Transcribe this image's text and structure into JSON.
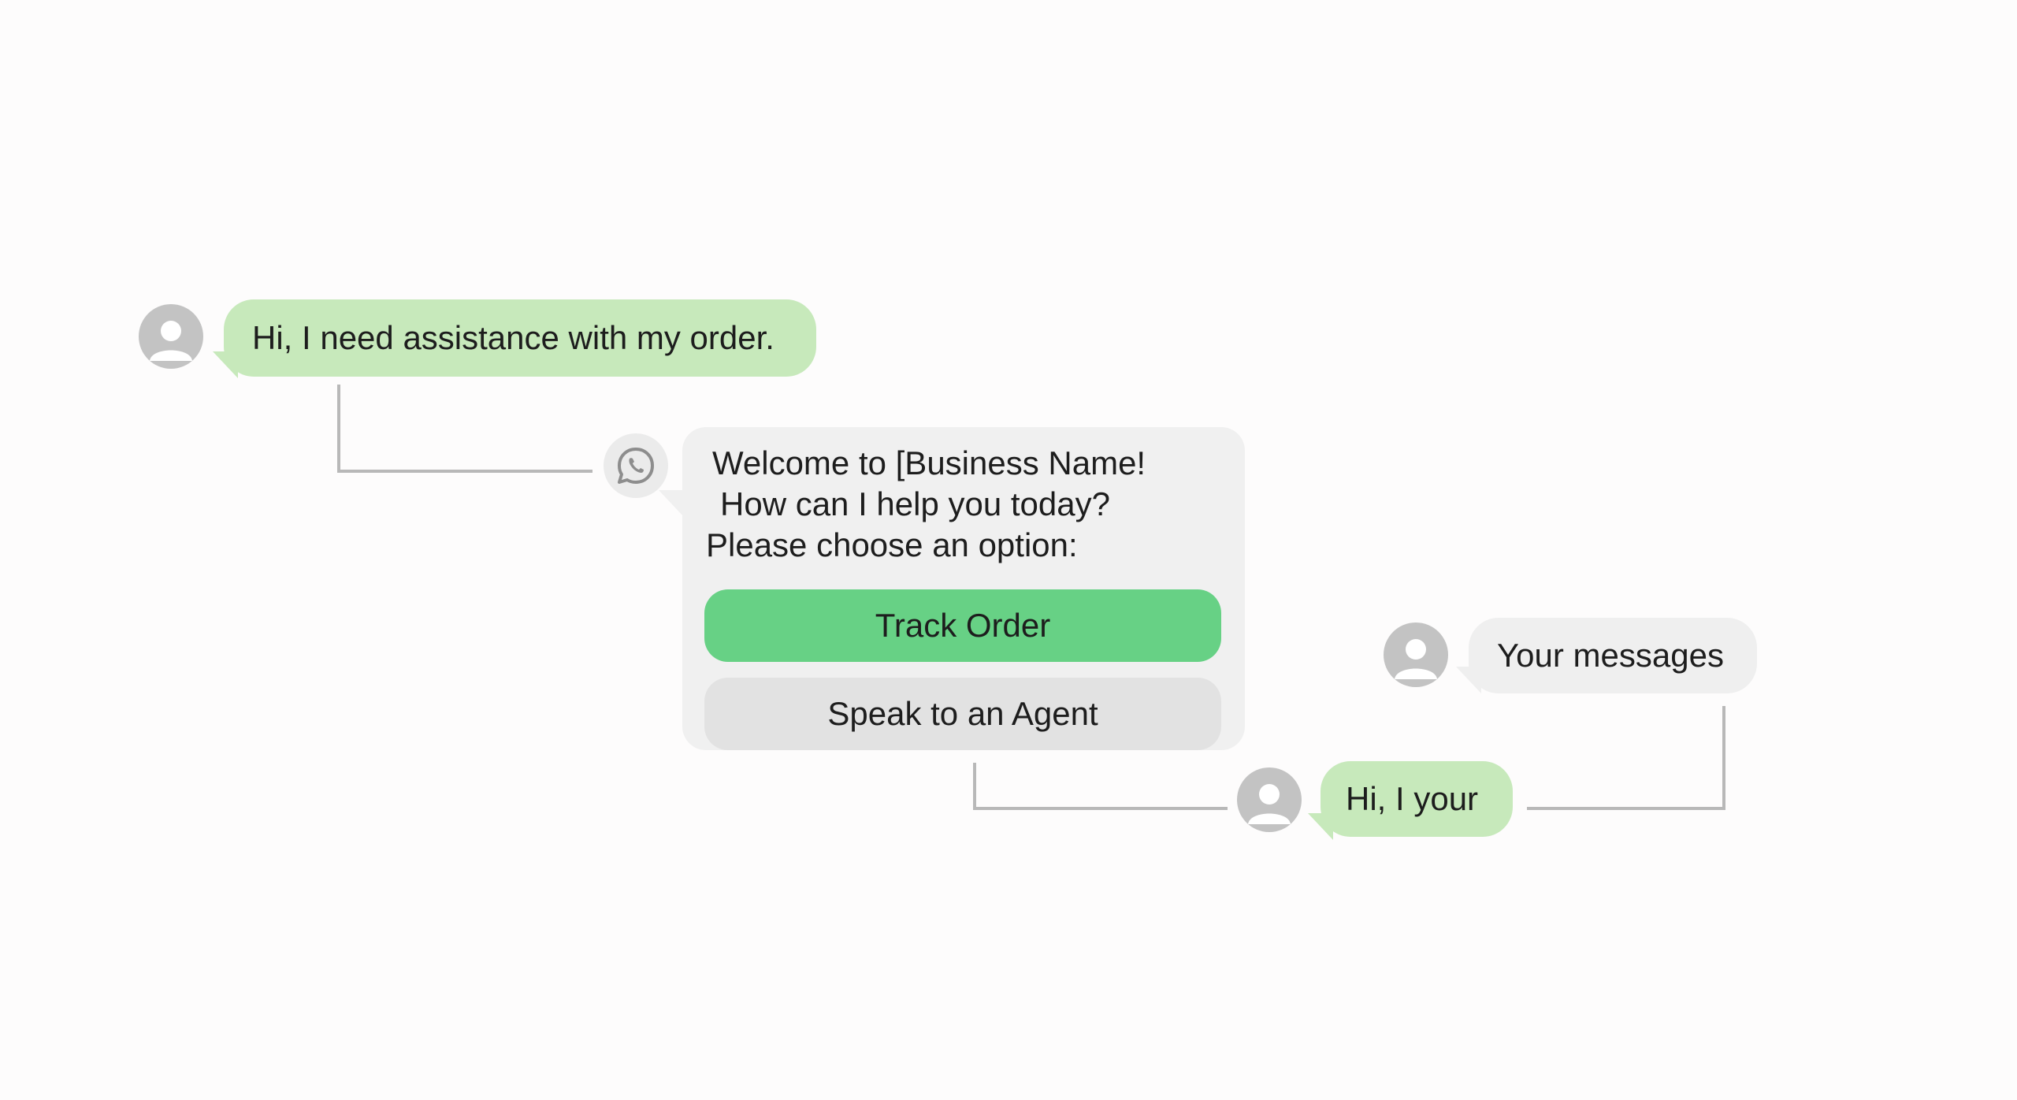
{
  "messages": {
    "first_user": "Hi, I need assistance with my order.",
    "bot_line_1": "Welcome to [Business Name!",
    "bot_line_2": "How can I help you today?",
    "bot_line_3": "Please choose an option:",
    "reply_user": "Hi, I your",
    "side_label": "Your messages"
  },
  "buttons": {
    "track_order": "Track Order",
    "speak_agent": "Speak to an Agent"
  },
  "icons": {
    "user_avatar": "user-avatar-icon",
    "bot_avatar": "whatsapp-icon"
  },
  "colors": {
    "user_bubble": "#c7e9bb",
    "bot_card": "#f0f0f0",
    "primary_button": "#67d185",
    "secondary_button": "#e2e2e2",
    "connector": "#b5b5b5"
  }
}
